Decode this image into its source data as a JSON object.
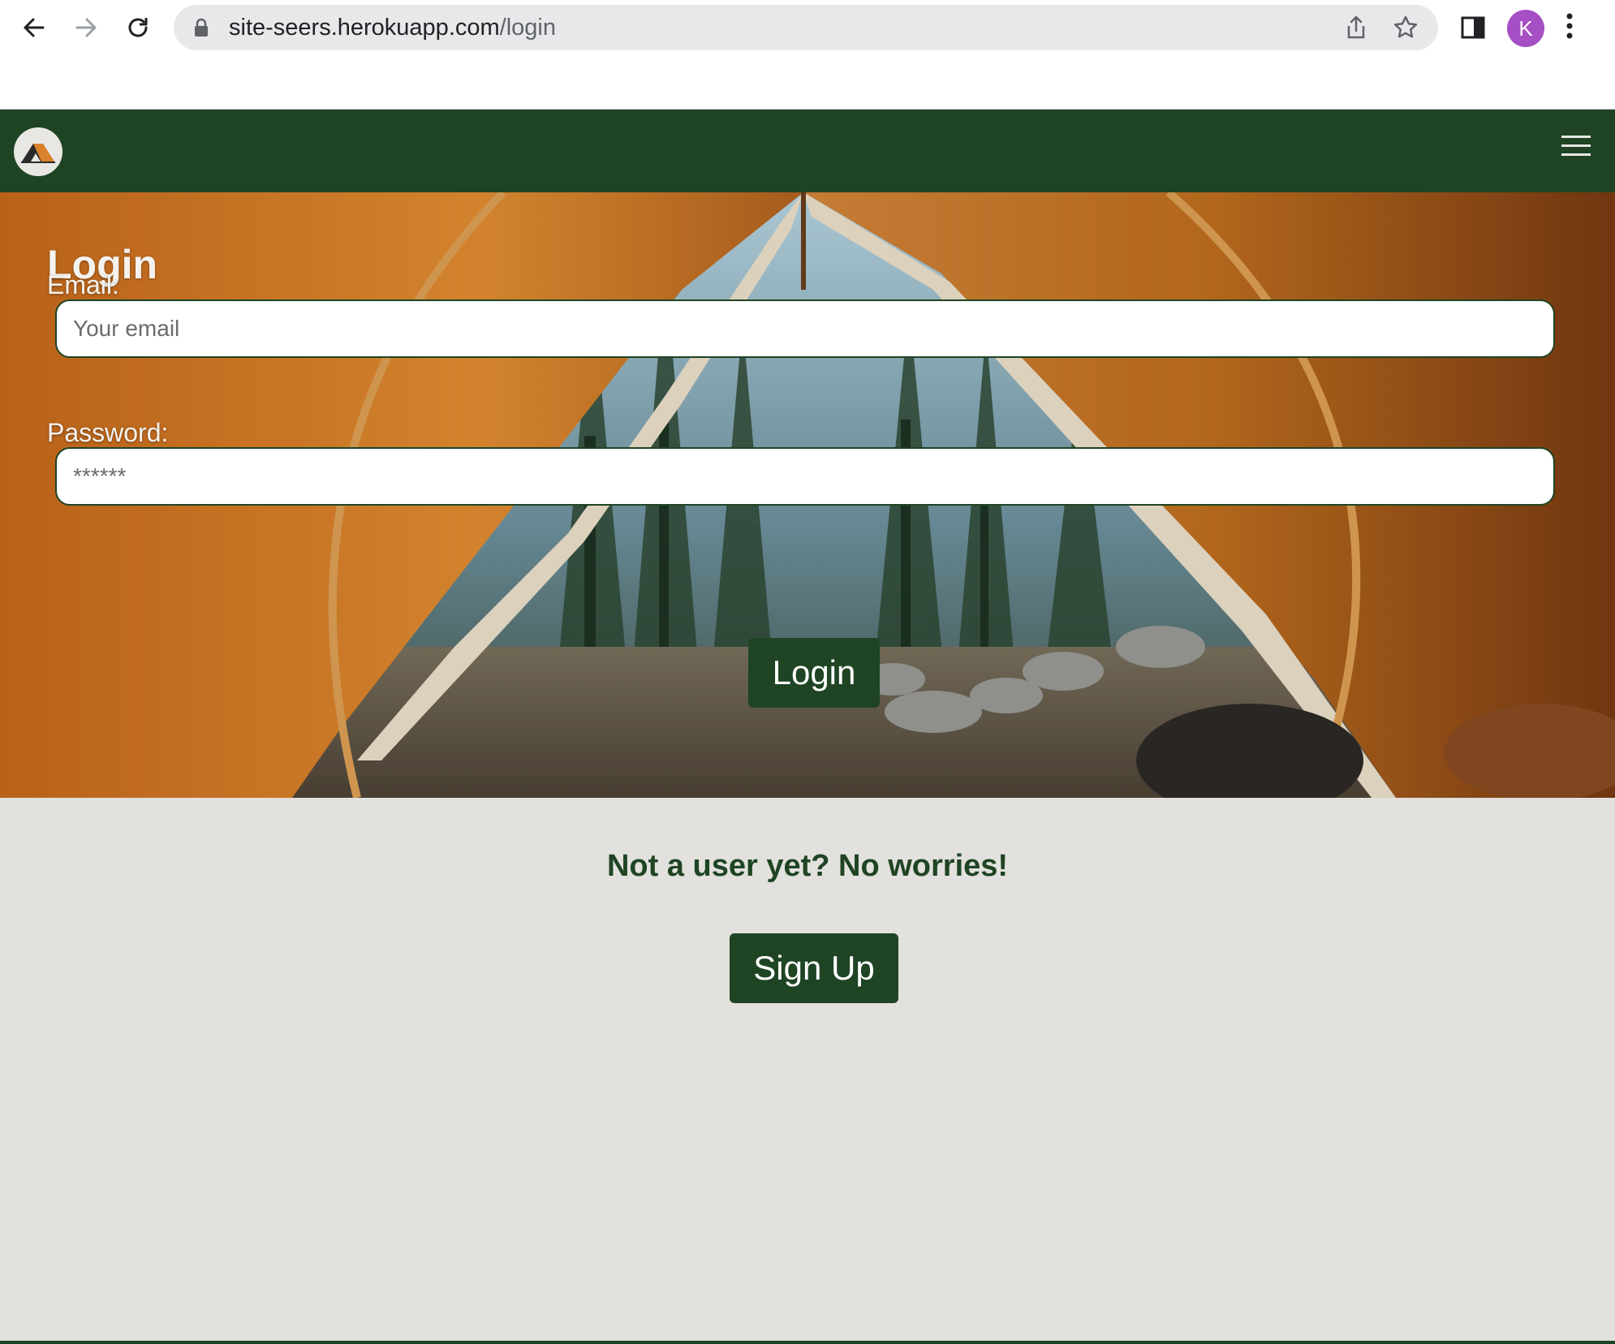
{
  "browser": {
    "url_host": "site-seers.herokuapp.com",
    "url_path": "/login",
    "profile_initial": "K"
  },
  "nav": {
    "logo_icon": "tent-icon",
    "menu_icon": "hamburger-icon"
  },
  "login": {
    "title": "Login",
    "email_label": "Email:",
    "email_placeholder": "Your email",
    "password_label": "Password:",
    "password_placeholder": "******",
    "submit_label": "Login"
  },
  "signup": {
    "prompt": "Not a user yet? No worries!",
    "button_label": "Sign Up"
  },
  "colors": {
    "brand_green": "#1f4424",
    "page_background": "#e2e1dd",
    "tent_orange": "#c9701f",
    "avatar_purple": "#a64fc4"
  }
}
